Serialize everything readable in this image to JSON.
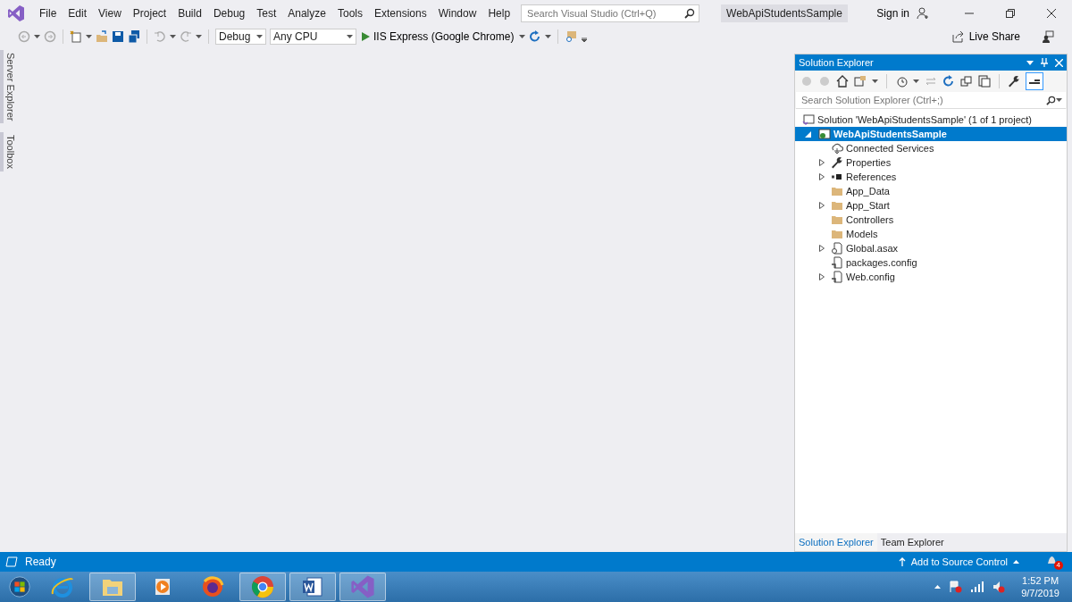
{
  "menu": {
    "items": [
      "File",
      "Edit",
      "View",
      "Project",
      "Build",
      "Debug",
      "Test",
      "Analyze",
      "Tools",
      "Extensions",
      "Window",
      "Help"
    ],
    "search": {
      "placeholder": "Search Visual Studio (Ctrl+Q)"
    },
    "project_title": "WebApiStudentsSample",
    "sign_in": "Sign in"
  },
  "toolbar": {
    "configuration": "Debug",
    "platform": "Any CPU",
    "run_target": "IIS Express (Google Chrome)",
    "live_share": "Live Share"
  },
  "side_tabs": [
    "Server Explorer",
    "Toolbox"
  ],
  "solution_explorer": {
    "title": "Solution Explorer",
    "search": {
      "placeholder": "Search Solution Explorer (Ctrl+;)"
    },
    "solution": "Solution 'WebApiStudentsSample' (1 of 1 project)",
    "project": {
      "label": "WebApiStudentsSample",
      "expanded": true,
      "selected": true,
      "children": [
        {
          "label": "Connected Services",
          "kind": "cloud",
          "collapsible": false,
          "selected": false
        },
        {
          "label": "Properties",
          "kind": "wrench",
          "collapsible": true,
          "selected": false
        },
        {
          "label": "References",
          "kind": "references",
          "collapsible": true,
          "selected": false
        },
        {
          "label": "App_Data",
          "kind": "folder",
          "collapsible": false,
          "selected": false
        },
        {
          "label": "App_Start",
          "kind": "folder",
          "collapsible": true,
          "selected": false
        },
        {
          "label": "Controllers",
          "kind": "folder",
          "collapsible": false,
          "selected": false
        },
        {
          "label": "Models",
          "kind": "folder",
          "collapsible": false,
          "selected": false
        },
        {
          "label": "Global.asax",
          "kind": "asax",
          "collapsible": true,
          "selected": false
        },
        {
          "label": "packages.config",
          "kind": "config",
          "collapsible": false,
          "selected": false
        },
        {
          "label": "Web.config",
          "kind": "config",
          "collapsible": true,
          "selected": false
        }
      ]
    },
    "tabs": [
      {
        "label": "Solution Explorer",
        "selected": true
      },
      {
        "label": "Team Explorer",
        "selected": false
      }
    ]
  },
  "status_bar": {
    "text": "Ready",
    "source_control": "Add to Source Control",
    "notifications": "4"
  },
  "taskbar": {
    "apps": [
      {
        "kind": "ie",
        "running": false
      },
      {
        "kind": "files",
        "running": true
      },
      {
        "kind": "media",
        "running": false
      },
      {
        "kind": "firefox",
        "running": false
      },
      {
        "kind": "chrome",
        "running": true
      },
      {
        "kind": "word",
        "running": true
      },
      {
        "kind": "vs",
        "running": true
      }
    ],
    "time": "1:52 PM",
    "date": "9/7/2019"
  }
}
